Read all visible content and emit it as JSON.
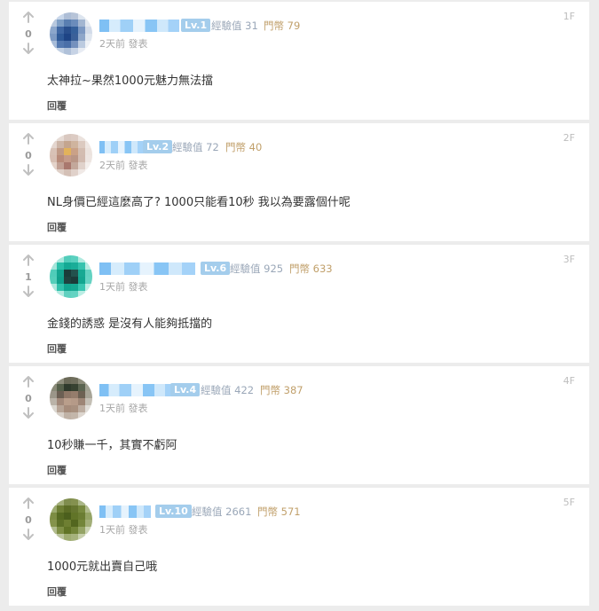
{
  "comments": [
    {
      "votes": "0",
      "level": "Lv.1",
      "exp_label": "經驗值",
      "exp": "31",
      "coin_label": "門幣",
      "coin": "79",
      "time": "2天前 發表",
      "content": "太神拉~果然1000元魅力無法擋",
      "reply": "回覆",
      "floor": "1F"
    },
    {
      "votes": "0",
      "level": "Lv.2",
      "exp_label": "經驗值",
      "exp": "72",
      "coin_label": "門幣",
      "coin": "40",
      "time": "2天前 發表",
      "content": "NL身價已經這麼高了? 1000只能看10秒 我以為要露個什呢",
      "reply": "回覆",
      "floor": "2F"
    },
    {
      "votes": "1",
      "level": "Lv.6",
      "exp_label": "經驗值",
      "exp": "925",
      "coin_label": "門幣",
      "coin": "633",
      "time": "1天前 發表",
      "content": "金錢的誘惑 是沒有人能夠抵擋的",
      "reply": "回覆",
      "floor": "3F"
    },
    {
      "votes": "0",
      "level": "Lv.4",
      "exp_label": "經驗值",
      "exp": "422",
      "coin_label": "門幣",
      "coin": "387",
      "time": "1天前 發表",
      "content": "10秒賺一千，其實不虧阿",
      "reply": "回覆",
      "floor": "4F"
    },
    {
      "votes": "0",
      "level": "Lv.10",
      "exp_label": "經驗值",
      "exp": "2661",
      "coin_label": "門幣",
      "coin": "571",
      "time": "1天前 發表",
      "content": "1000元就出賣自己哦",
      "reply": "回覆",
      "floor": "5F"
    }
  ],
  "icons": {
    "upvote": "arrow-up-icon",
    "downvote": "arrow-down-icon"
  },
  "colors": {
    "background": "#ececec",
    "card": "#ffffff",
    "level_badge": "#a4cdec",
    "exp": "#9aa7b8",
    "coin": "#c1a06b"
  }
}
